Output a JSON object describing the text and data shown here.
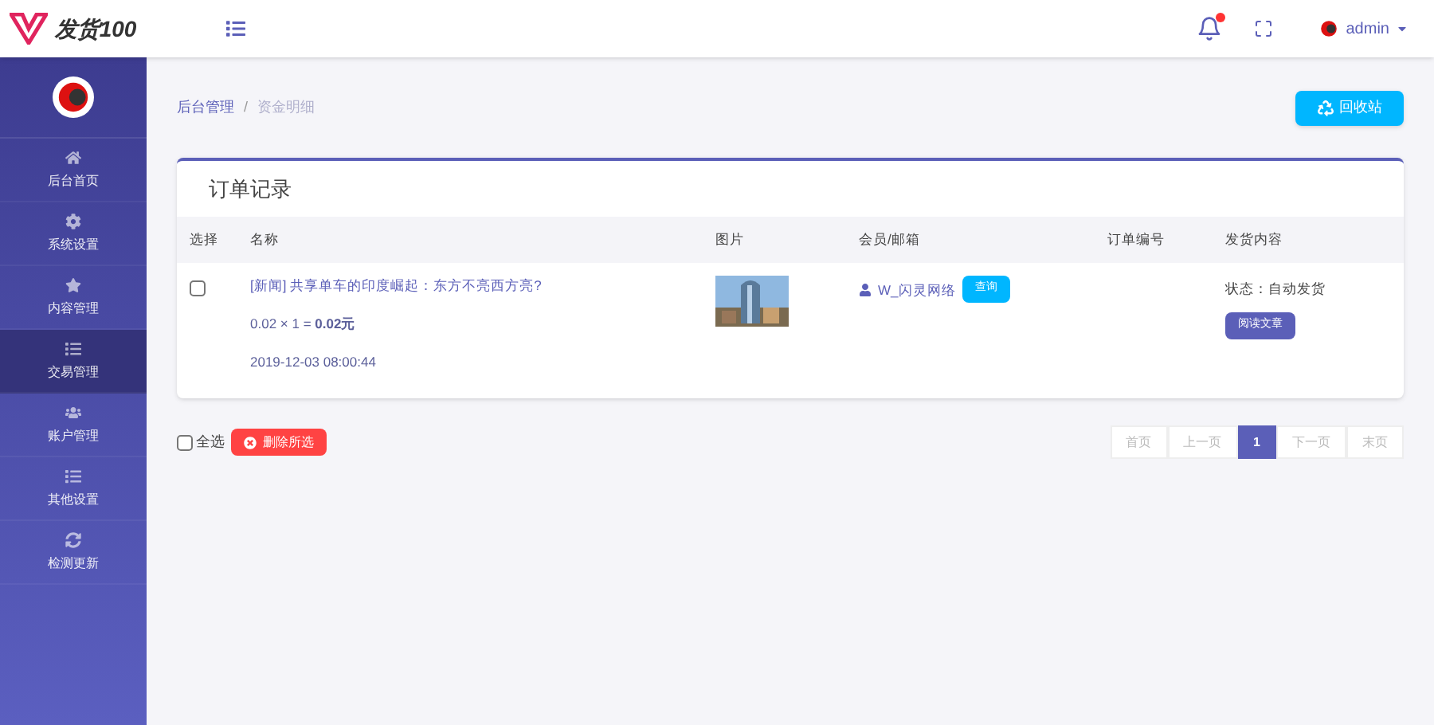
{
  "header": {
    "logo": "发货100",
    "user": "admin",
    "notification": true
  },
  "sidebar": {
    "items": [
      {
        "label": "后台首页",
        "kind": "home",
        "selected": false
      },
      {
        "label": "系统设置",
        "kind": "gear",
        "selected": false
      },
      {
        "label": "内容管理",
        "kind": "star",
        "selected": false
      },
      {
        "label": "交易管理",
        "kind": "list",
        "selected": true
      },
      {
        "label": "账户管理",
        "kind": "users",
        "selected": false
      },
      {
        "label": "其他设置",
        "kind": "list",
        "selected": false
      },
      {
        "label": "检测更新",
        "kind": "refresh",
        "selected": false
      }
    ]
  },
  "breadcrumb": [
    "后台管理",
    "资金明细"
  ],
  "breadcrumb_separator": "/",
  "recycle_button": "回收站",
  "card": {
    "title": "订单记录",
    "columns": [
      "选择",
      "名称",
      "图片",
      "会员/邮箱",
      "订单编号",
      "发货内容"
    ],
    "rows": [
      {
        "checked": false,
        "title": "[新闻] 共享单车的印度崛起：东方不亮西方亮?",
        "price": "0.02 × 1 = **0.02元**",
        "time": "2019-12-03 08:00:44",
        "member": "W_闪灵网络",
        "query_button": "查询",
        "status": "状态：自动发货",
        "read_button": "阅读文章"
      }
    ]
  },
  "select_all": {
    "label": "全选",
    "checked": false
  },
  "delete_button": "删除所选",
  "pagination": [
    {
      "label": "首页",
      "selected": false
    },
    {
      "label": "上一页",
      "selected": false
    },
    {
      "label": "1",
      "selected": true
    },
    {
      "label": "下一页",
      "selected": false
    },
    {
      "label": "末页",
      "selected": false
    }
  ]
}
